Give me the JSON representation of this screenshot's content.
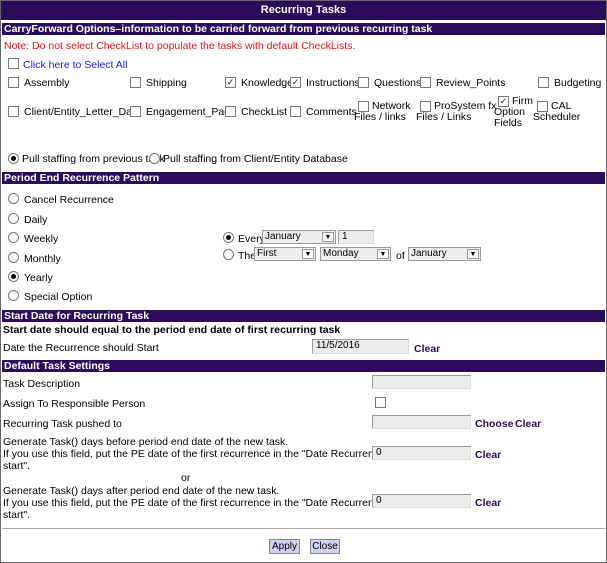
{
  "title": "Recurring Tasks",
  "carry": {
    "header": "CarryForward Options–information to be carried forward from previous recurring task",
    "note": "Note: Do not select CheckList to populate the tasks with default CheckLists.",
    "select_all": "Click here to Select All",
    "items": [
      {
        "label": "Assembly",
        "checked": false
      },
      {
        "label": "Shipping",
        "checked": false
      },
      {
        "label": "Knowledge",
        "checked": true
      },
      {
        "label": "Instructions",
        "checked": true
      },
      {
        "label": "Questions",
        "checked": false
      },
      {
        "label": "Review_Points",
        "checked": false
      },
      {
        "label": "Budgeting",
        "checked": false
      },
      {
        "label": "Client/Entity_Letter_Date",
        "checked": false
      },
      {
        "label": "Engagement_Page",
        "checked": false
      },
      {
        "label": "CheckList",
        "checked": false
      },
      {
        "label": "Comments",
        "checked": false
      },
      {
        "label": "Network Files / links",
        "checked": false
      },
      {
        "label": "ProSystem fx Files / Links",
        "checked": false
      },
      {
        "label": "Firm Option Fields",
        "checked": true
      },
      {
        "label": "CAL Scheduler",
        "checked": false
      }
    ],
    "staffing": [
      {
        "label": "Pull staffing from previous task",
        "selected": true
      },
      {
        "label": "Pull staffing from Client/Entity Database",
        "selected": false
      }
    ]
  },
  "pattern": {
    "header": "Period End Recurrence Pattern",
    "options": [
      {
        "label": "Cancel Recurrence",
        "selected": false
      },
      {
        "label": "Daily",
        "selected": false
      },
      {
        "label": "Weekly",
        "selected": false
      },
      {
        "label": "Monthly",
        "selected": false
      },
      {
        "label": "Yearly",
        "selected": true
      },
      {
        "label": "Special Option",
        "selected": false
      }
    ],
    "every_label": "Every",
    "every_month": "January",
    "every_day": "1",
    "the_label": "The",
    "the_ordinal": "First",
    "the_weekday": "Monday",
    "of_label": "of",
    "the_month": "January"
  },
  "start": {
    "header": "Start Date for Recurring Task",
    "note": "Start date should equal to the period end date of first recurring task",
    "date_label": "Date the Recurrence should Start",
    "date_value": "11/5/2016",
    "clear": "Clear"
  },
  "defaults": {
    "header": "Default Task Settings",
    "task_description": "Task Description",
    "task_description_value": "",
    "assign": "Assign To Responsible Person",
    "pushed": "Recurring Task pushed to",
    "pushed_value": "",
    "choose": "Choose",
    "clear": "Clear",
    "before_1": "Generate Task() days before period end date of the new task.",
    "before_2": "If you use this field, put the PE date of the first recurrence in the \"Date Recurrence should",
    "before_3": "start\".",
    "before_value": "0",
    "or": "or",
    "after_1": "Generate Task() days after period end date of the new task.",
    "after_2": "If you use this field, put the PE date of the first recurrence in the \"Date Recurrence should",
    "after_3": "start\".",
    "after_value": "0"
  },
  "buttons": {
    "apply": "Apply",
    "close": "Close"
  }
}
